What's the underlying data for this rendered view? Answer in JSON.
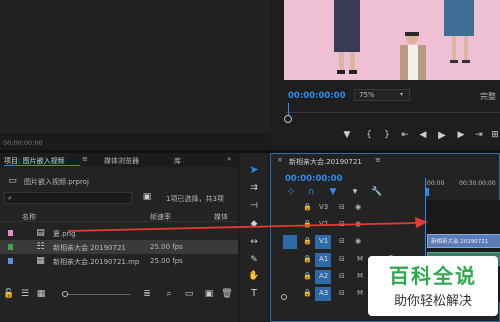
{
  "source_monitor": {
    "timecode": "00;00;00;00"
  },
  "program_monitor": {
    "timecode": "00:00:00:00",
    "zoom": "75%",
    "quality": "完整"
  },
  "project_panel": {
    "tabs": [
      "项目: 图片嵌入视频",
      "媒体浏览器",
      "库"
    ],
    "project_file": "图片嵌入视频.prproj",
    "selection_info": "1项已选择，共3项",
    "columns": {
      "name": "名称",
      "frame_rate": "帧速率",
      "media": "媒体"
    },
    "rows": [
      {
        "name": "夏.png",
        "fps": ""
      },
      {
        "name": "新相亲大会 20190721",
        "fps": "25.00 fps"
      },
      {
        "name": "新相亲大会.20190721.mp",
        "fps": "25.00 fps"
      }
    ]
  },
  "timeline": {
    "sequence_tab": "新相亲大会.20190721",
    "timecode": "00:00:00:00",
    "ruler": [
      ":00:00",
      "00:30:00:00"
    ],
    "video_tracks": [
      "V3",
      "V2",
      "V1"
    ],
    "audio_tracks": [
      "A1",
      "A2",
      "A3"
    ],
    "clip_label": "新相亲大会.20190721",
    "audio_meter": "S"
  },
  "watermark": {
    "title": "百科全说",
    "subtitle": "助你轻松解决"
  },
  "colors": {
    "accent_blue": "#2d8ceb",
    "label_pink": "#e58fd1",
    "label_green": "#3fa64a",
    "label_blue": "#5d8de0",
    "preview_pink": "#efbfd3",
    "arrow_red": "#e53935"
  }
}
